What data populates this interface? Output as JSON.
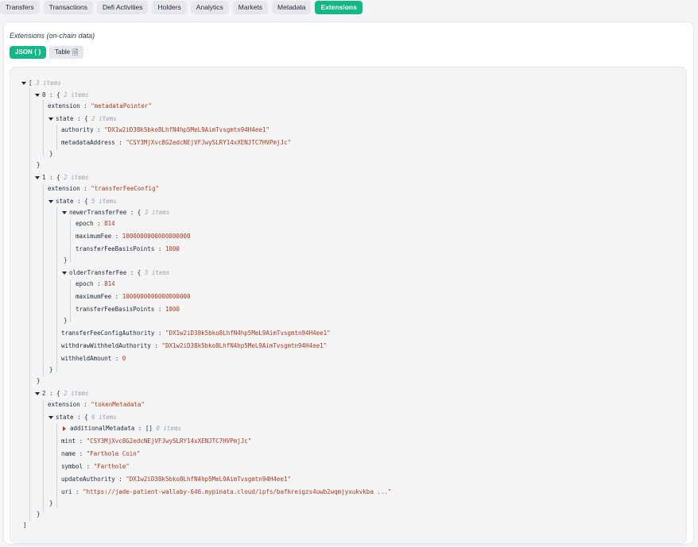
{
  "tabs": [
    "Transfers",
    "Transactions",
    "Defi Activities",
    "Holders",
    "Analytics",
    "Markets",
    "Metadata",
    "Extensions"
  ],
  "active_tab": "Extensions",
  "section_title": "Extensions (on-chain data)",
  "view_toggle": {
    "json_label": "JSON { }",
    "table_label": "Table"
  },
  "tree": {
    "root_count": "3 items",
    "items": [
      {
        "index": "0",
        "count": "2 items",
        "extension": "\"metadataPointer\"",
        "state_count": "2 items",
        "authority": "\"DX1w2iD38k5bko8LhfN4hp5MeL9AimTvsgmtn94H4ee1\"",
        "metadataAddress": "\"CSY3MjXvc8G2edcNEjVFJwySLRY14xXENJTC7HVPmjJc\""
      },
      {
        "index": "1",
        "count": "2 items",
        "extension": "\"transferFeeConfig\"",
        "state_count": "5 items",
        "newer_count": "3 items",
        "newer_epoch": "814",
        "newer_maximumFee": "1000000000000000000",
        "newer_bps": "1000",
        "older_count": "3 items",
        "older_epoch": "814",
        "older_maximumFee": "1000000000000000000",
        "older_bps": "1000",
        "transferFeeConfigAuthority": "\"DX1w2iD38k5bko8LhfN4hp5MeL9AimTvsgmtn94H4ee1\"",
        "withdrawWithheldAuthority": "\"DX1w2iD38k5bko8LhfN4hp5MeL9AimTvsgmtn94H4ee1\"",
        "withheldAmount": "0"
      },
      {
        "index": "2",
        "count": "2 items",
        "extension": "\"tokenMetadata\"",
        "state_count": "6 items",
        "additional_count": "0 items",
        "mint": "\"CSY3MjXvc8G2edcNEjVFJwySLRY14xXENJTC7HVPmjJc\"",
        "name": "\"Farthole Coin\"",
        "symbol": "\"Farthole\"",
        "updateAuthority": "\"DX1w2iD38k5bko8LhfN4hp5MeL9AimTvsgmtn94H4ee1\"",
        "uri": "\"https://jade-patient-wallaby-646.mypinata.cloud/ipfs/bafkreigzs4uwb2wqmjyxukvkba  ...\""
      }
    ]
  }
}
